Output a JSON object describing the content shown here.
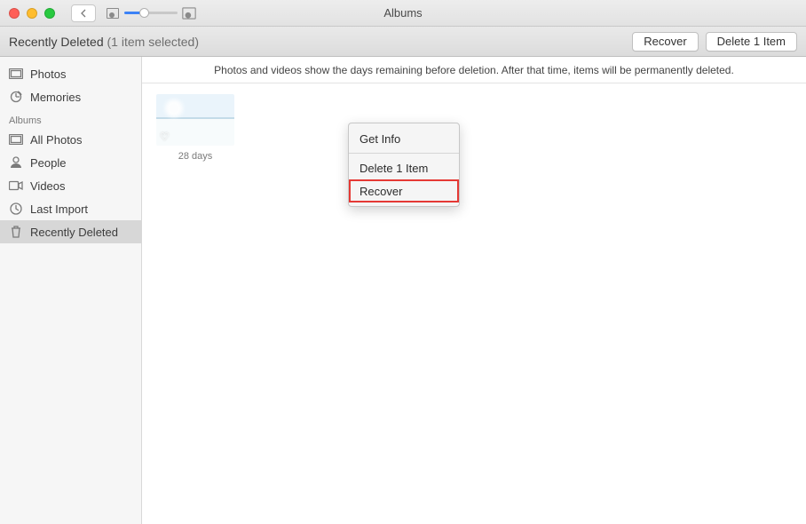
{
  "window": {
    "title": "Albums"
  },
  "toolbar": {
    "breadcrumb_title": "Recently Deleted",
    "selection_count": "(1 item selected)",
    "recover_label": "Recover",
    "delete_label": "Delete 1 Item"
  },
  "sidebar": {
    "library": [
      {
        "label": "Photos",
        "icon": "photos-icon"
      },
      {
        "label": "Memories",
        "icon": "memories-icon"
      }
    ],
    "albums_header": "Albums",
    "albums": [
      {
        "label": "All Photos",
        "icon": "all-photos-icon"
      },
      {
        "label": "People",
        "icon": "people-icon"
      },
      {
        "label": "Videos",
        "icon": "videos-icon"
      },
      {
        "label": "Last Import",
        "icon": "clock-icon"
      },
      {
        "label": "Recently Deleted",
        "icon": "trash-icon",
        "selected": true
      }
    ]
  },
  "content": {
    "notice": "Photos and videos show the days remaining before deletion. After that time, items will be permanently deleted.",
    "items": [
      {
        "days_label": "28 days"
      }
    ]
  },
  "context_menu": [
    {
      "label": "Get Info"
    },
    {
      "label": "Delete 1 Item"
    },
    {
      "label": "Recover",
      "highlighted": true
    }
  ]
}
